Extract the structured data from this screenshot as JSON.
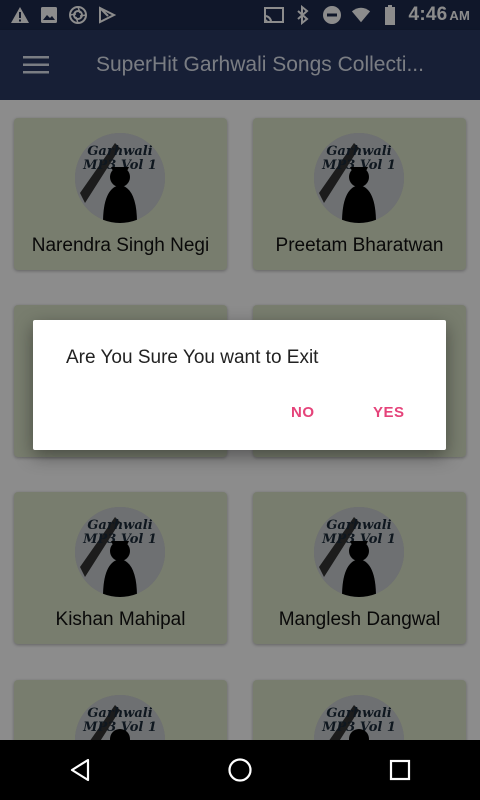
{
  "status_bar": {
    "time": "4:46",
    "ampm": "AM",
    "left_icons": [
      "warning-icon",
      "image-icon",
      "shutter-icon",
      "play-store-icon"
    ],
    "right_icons": [
      "cast-icon",
      "bluetooth-icon",
      "do-not-disturb-icon",
      "wifi-icon",
      "battery-icon"
    ]
  },
  "app_bar": {
    "title": "SuperHit Garhwali Songs Collecti...",
    "menu_icon": "hamburger-menu-icon"
  },
  "cards": [
    {
      "label": "Narendra Singh Negi",
      "thumb_text": "Garhwali MP3 Vol 1"
    },
    {
      "label": "Preetam Bharatwan",
      "thumb_text": "Garhwali MP3 Vol 1"
    },
    {
      "label": "",
      "thumb_text": ""
    },
    {
      "label": "",
      "thumb_text": ""
    },
    {
      "label": "Kishan Mahipal",
      "thumb_text": "Garhwali MP3 Vol 1"
    },
    {
      "label": "Manglesh Dangwal",
      "thumb_text": "Garhwali MP3 Vol 1"
    },
    {
      "label": "",
      "thumb_text": "Garhwali MP3 Vol 1"
    },
    {
      "label": "",
      "thumb_text": "Garhwali MP3 Vol 1"
    }
  ],
  "dialog": {
    "message": "Are You Sure You want to Exit",
    "no_label": "NO",
    "yes_label": "YES"
  },
  "nav_bar": {
    "back_icon": "back-icon",
    "home_icon": "home-icon",
    "recents_icon": "recents-icon"
  },
  "colors": {
    "status_bar": "#1e2b4e",
    "app_bar": "#2b3a63",
    "card": "#dbe3c8",
    "accent": "#e5437a"
  }
}
